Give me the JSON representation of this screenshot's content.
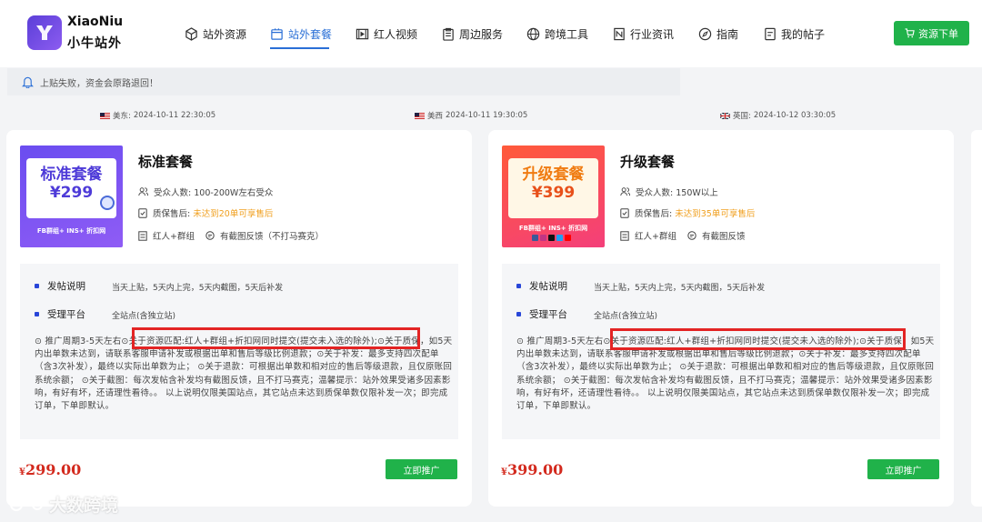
{
  "brand": {
    "name_en": "XiaoNiu",
    "name_cn": "小牛站外"
  },
  "nav": [
    {
      "label": "站外资源",
      "icon": "cube-icon"
    },
    {
      "label": "站外套餐",
      "icon": "package-icon",
      "active": true
    },
    {
      "label": "红人视频",
      "icon": "video-icon"
    },
    {
      "label": "周边服务",
      "icon": "clipboard-icon"
    },
    {
      "label": "跨境工具",
      "icon": "globe-icon"
    },
    {
      "label": "行业资讯",
      "icon": "news-icon"
    },
    {
      "label": "指南",
      "icon": "compass-icon"
    },
    {
      "label": "我的帖子",
      "icon": "document-icon"
    }
  ],
  "header": {
    "download_label": "资源下单"
  },
  "notice": {
    "text": "上贴失败，资金会原路退回！"
  },
  "timezones": [
    {
      "label": "美东:",
      "time": "2024-10-11 22:30:05",
      "flag": "us"
    },
    {
      "label": "美西",
      "time": "2024-10-11 19:30:05",
      "flag": "us"
    },
    {
      "label": "英国:",
      "time": "2024-10-12 03:30:05",
      "flag": "uk"
    }
  ],
  "cards": [
    {
      "title": "标准套餐",
      "thumb_title": "标准套餐",
      "thumb_price": "¥299",
      "thumb_tag": "FB群组+ INS+ 折扣网",
      "audience_label": "受众人数:",
      "audience": "100-200W左右受众",
      "after_sale_label": "质保售后:",
      "after_sale": "未达到20单可享售后",
      "feature_a": "红人+群组",
      "feature_b": "有截图反馈（不打马赛克）",
      "posting_label": "发帖说明",
      "posting": "当天上贴，5天内上完，5天内截图，5天后补发",
      "platform_label": "受理平台",
      "platform": "全站点(含独立站)",
      "para_a": "⊙ 推广周期3-5天左右",
      "para_hl": "⊙关于资源匹配:红人+群组+折扣网同时提交(提交未入选的除外);",
      "para_b": "⊙关于质保，如5天内出单数未达到，请联系客服申请补发或根据出单和售后等级比例退款；⊙关于补发：最多支持四次配单（含3次补发），最终以实际出单数为止；  ⊙关于退款：可根据出单数和相对应的售后等级退款，且仅原账回系统余额；  ⊙关于截图：每次发帖含补发均有截图反馈，且不打马赛克；温馨提示：站外效果受诸多因素影响，有好有坏，还请理性看待。。 以上说明仅限美国站点，其它站点未达到质保单数仅限补发一次；即完成订单，下单即默认。",
      "price": "299.00",
      "currency": "¥",
      "button": "立即推广"
    },
    {
      "title": "升级套餐",
      "thumb_title": "升级套餐",
      "thumb_price": "¥399",
      "thumb_tag": "FB群组+ INS+ 折扣网",
      "audience_label": "受众人数:",
      "audience": "150W以上",
      "after_sale_label": "质保售后:",
      "after_sale": "未达到35单可享售后",
      "feature_a": "红人+群组",
      "feature_b": "有截图反馈",
      "posting_label": "发帖说明",
      "posting": "当天上贴，5天内上完，5天内截图，5天后补发",
      "platform_label": "受理平台",
      "platform": "全站点(含独立站)",
      "para_a": "⊙ 推广周期3-5天左右",
      "para_hl": "⊙关于资源匹配:红人+群组+折扣网同时提交(提交未入选的除外);",
      "para_b": "⊙关于质保，如5天内出单数未达到，请联系客服申请补发或根据出单和售后等级比例退款；⊙关于补发：最多支持四次配单（含3次补发），最终以实际出单数为止；  ⊙关于退款：可根据出单数和相对应的售后等级退款，且仅原账回系统余额；  ⊙关于截图：每次发帖含补发均有截图反馈，且不打马赛克；温馨提示：站外效果受诸多因素影响，有好有坏，还请理性看待。。 以上说明仅限美国站点，其它站点未达到质保单数仅限补发一次；即完成订单，下单即默认。",
      "price": "399.00",
      "currency": "¥",
      "button": "立即推广"
    }
  ],
  "watermark": "大数跨境"
}
